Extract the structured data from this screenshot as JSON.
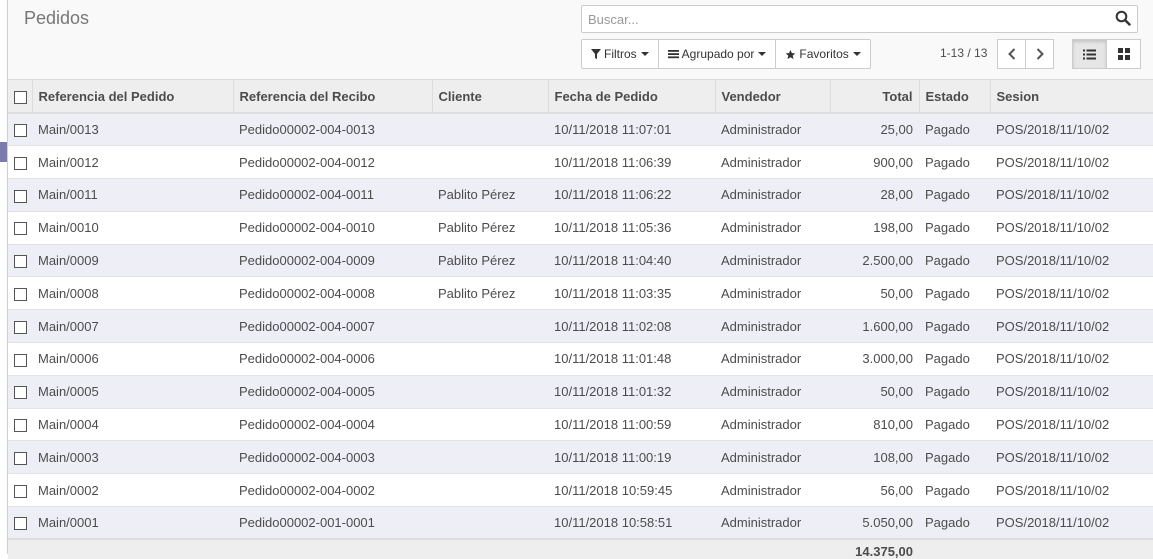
{
  "page": {
    "title": "Pedidos"
  },
  "search": {
    "placeholder": "Buscar..."
  },
  "toolbar": {
    "filters_label": "Filtros",
    "groupby_label": "Agrupado por",
    "favorites_label": "Favoritos"
  },
  "pager": {
    "value": "1-13 / 13"
  },
  "table": {
    "headers": {
      "order_ref": "Referencia del Pedido",
      "receipt_ref": "Referencia del Recibo",
      "customer": "Cliente",
      "order_date": "Fecha de Pedido",
      "salesperson": "Vendedor",
      "total": "Total",
      "state": "Estado",
      "session": "Sesion"
    },
    "rows": [
      {
        "order_ref": "Main/0013",
        "receipt_ref": "Pedido00002-004-0013",
        "customer": "",
        "order_date": "10/11/2018 11:07:01",
        "salesperson": "Administrador",
        "total": "25,00",
        "state": "Pagado",
        "session": "POS/2018/11/10/02"
      },
      {
        "order_ref": "Main/0012",
        "receipt_ref": "Pedido00002-004-0012",
        "customer": "",
        "order_date": "10/11/2018 11:06:39",
        "salesperson": "Administrador",
        "total": "900,00",
        "state": "Pagado",
        "session": "POS/2018/11/10/02"
      },
      {
        "order_ref": "Main/0011",
        "receipt_ref": "Pedido00002-004-0011",
        "customer": "Pablito Pérez",
        "order_date": "10/11/2018 11:06:22",
        "salesperson": "Administrador",
        "total": "28,00",
        "state": "Pagado",
        "session": "POS/2018/11/10/02"
      },
      {
        "order_ref": "Main/0010",
        "receipt_ref": "Pedido00002-004-0010",
        "customer": "Pablito Pérez",
        "order_date": "10/11/2018 11:05:36",
        "salesperson": "Administrador",
        "total": "198,00",
        "state": "Pagado",
        "session": "POS/2018/11/10/02"
      },
      {
        "order_ref": "Main/0009",
        "receipt_ref": "Pedido00002-004-0009",
        "customer": "Pablito Pérez",
        "order_date": "10/11/2018 11:04:40",
        "salesperson": "Administrador",
        "total": "2.500,00",
        "state": "Pagado",
        "session": "POS/2018/11/10/02"
      },
      {
        "order_ref": "Main/0008",
        "receipt_ref": "Pedido00002-004-0008",
        "customer": "Pablito Pérez",
        "order_date": "10/11/2018 11:03:35",
        "salesperson": "Administrador",
        "total": "50,00",
        "state": "Pagado",
        "session": "POS/2018/11/10/02"
      },
      {
        "order_ref": "Main/0007",
        "receipt_ref": "Pedido00002-004-0007",
        "customer": "",
        "order_date": "10/11/2018 11:02:08",
        "salesperson": "Administrador",
        "total": "1.600,00",
        "state": "Pagado",
        "session": "POS/2018/11/10/02"
      },
      {
        "order_ref": "Main/0006",
        "receipt_ref": "Pedido00002-004-0006",
        "customer": "",
        "order_date": "10/11/2018 11:01:48",
        "salesperson": "Administrador",
        "total": "3.000,00",
        "state": "Pagado",
        "session": "POS/2018/11/10/02"
      },
      {
        "order_ref": "Main/0005",
        "receipt_ref": "Pedido00002-004-0005",
        "customer": "",
        "order_date": "10/11/2018 11:01:32",
        "salesperson": "Administrador",
        "total": "50,00",
        "state": "Pagado",
        "session": "POS/2018/11/10/02"
      },
      {
        "order_ref": "Main/0004",
        "receipt_ref": "Pedido00002-004-0004",
        "customer": "",
        "order_date": "10/11/2018 11:00:59",
        "salesperson": "Administrador",
        "total": "810,00",
        "state": "Pagado",
        "session": "POS/2018/11/10/02"
      },
      {
        "order_ref": "Main/0003",
        "receipt_ref": "Pedido00002-004-0003",
        "customer": "",
        "order_date": "10/11/2018 11:00:19",
        "salesperson": "Administrador",
        "total": "108,00",
        "state": "Pagado",
        "session": "POS/2018/11/10/02"
      },
      {
        "order_ref": "Main/0002",
        "receipt_ref": "Pedido00002-004-0002",
        "customer": "",
        "order_date": "10/11/2018 10:59:45",
        "salesperson": "Administrador",
        "total": "56,00",
        "state": "Pagado",
        "session": "POS/2018/11/10/02"
      },
      {
        "order_ref": "Main/0001",
        "receipt_ref": "Pedido00002-001-0001",
        "customer": "",
        "order_date": "10/11/2018 10:58:51",
        "salesperson": "Administrador",
        "total": "5.050,00",
        "state": "Pagado",
        "session": "POS/2018/11/10/02"
      }
    ],
    "footer_total": "14.375,00"
  },
  "colors": {
    "odd_row": "#eeeef6",
    "header_bg": "#eeeeee",
    "accent": "#7c7bad"
  }
}
